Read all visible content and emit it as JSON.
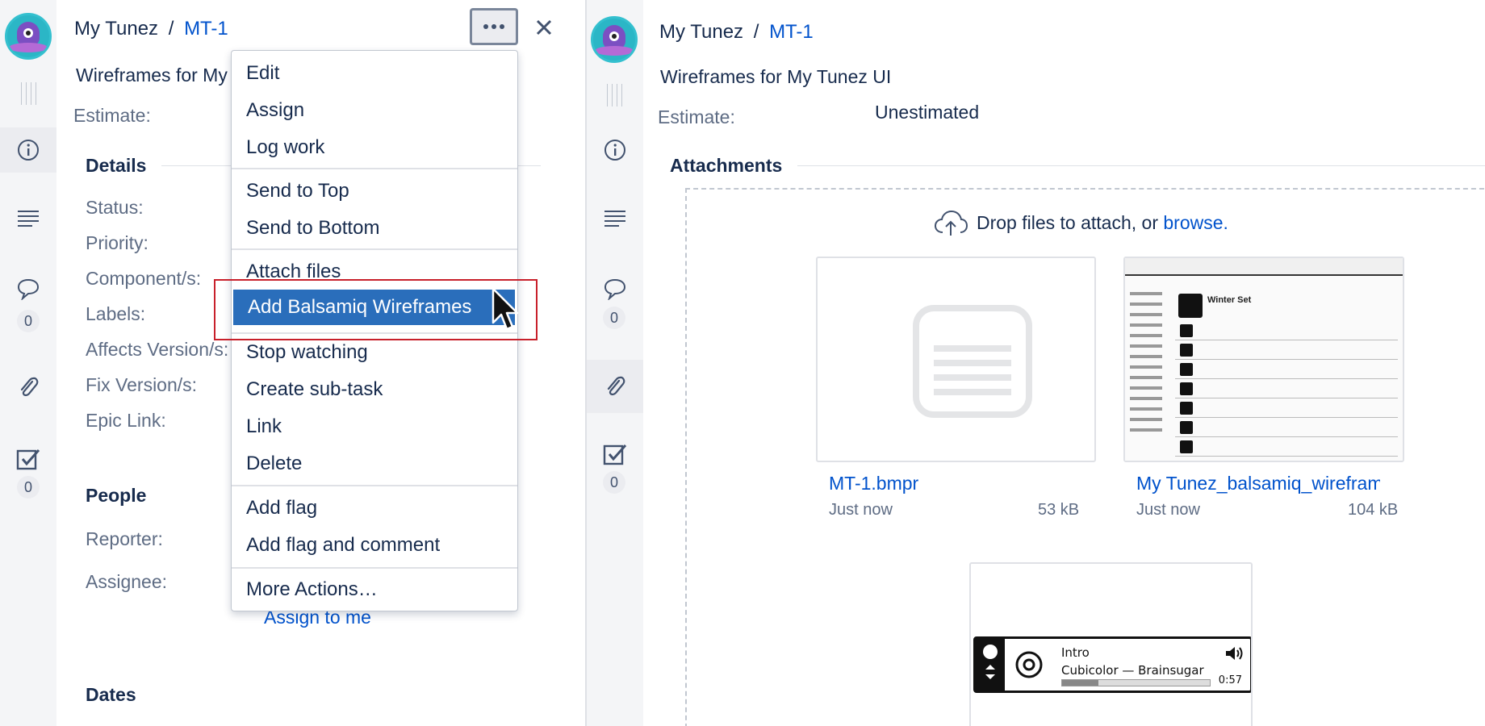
{
  "left_panel": {
    "breadcrumb": {
      "project": "My Tunez",
      "separator": "/",
      "issue": "MT-1"
    },
    "summary": "Wireframes for My Tunez UI",
    "estimate_label": "Estimate:",
    "rail_counts": {
      "comments": "0",
      "checklist": "0"
    },
    "details": {
      "heading": "Details",
      "fields": [
        "Status:",
        "Priority:",
        "Component/s:",
        "Labels:",
        "Affects Version/s:",
        "Fix Version/s:",
        "Epic Link:"
      ]
    },
    "people": {
      "heading": "People",
      "reporter_label": "Reporter:",
      "assignee_label": "Assignee:",
      "assign_to_me": "Assign to me"
    },
    "dates_heading": "Dates"
  },
  "menu": {
    "groups": [
      [
        "Edit",
        "Assign",
        "Log work"
      ],
      [
        "Send to Top",
        "Send to Bottom"
      ],
      [
        "Attach files",
        "Add Balsamiq Wireframes"
      ],
      [
        "Stop watching",
        "Create sub-task",
        "Link",
        "Delete"
      ],
      [
        "Add flag",
        "Add flag and comment"
      ],
      [
        "More Actions…"
      ]
    ],
    "highlighted": "Add Balsamiq Wireframes"
  },
  "right_panel": {
    "breadcrumb": {
      "project": "My Tunez",
      "separator": "/",
      "issue": "MT-1"
    },
    "summary": "Wireframes for My Tunez UI",
    "estimate_label": "Estimate:",
    "estimate_value": "Unestimated",
    "rail_counts": {
      "comments": "0",
      "checklist": "0"
    },
    "attachments": {
      "heading": "Attachments",
      "drop_prefix": "Drop files to attach, or ",
      "drop_link": "browse.",
      "files": [
        {
          "name": "MT-1.bmpr",
          "time": "Just now",
          "size": "53 kB"
        },
        {
          "name": "My Tunez_balsamiq_wireframes",
          "time": "Just now",
          "size": "104 kB"
        }
      ],
      "wireframe_preview": {
        "title": "Winter Set"
      },
      "player_preview": {
        "track": "Intro",
        "artist": "Cubicolor — Brainsugar",
        "time": "0:57"
      }
    }
  }
}
